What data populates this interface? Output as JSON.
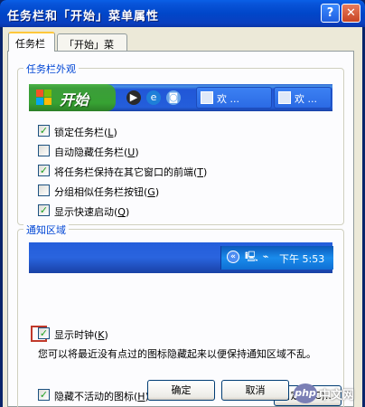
{
  "window": {
    "title": "任务栏和「开始」菜单属性",
    "help_label": "?",
    "close_label": "✕"
  },
  "tabs": [
    {
      "label": "任务栏",
      "active": true
    },
    {
      "label": "「开始」菜单",
      "active": false
    }
  ],
  "appearance": {
    "legend": "任务栏外观",
    "preview": {
      "start_label": "开始",
      "task_buttons": [
        "欢 ...",
        "欢 ..."
      ]
    },
    "options": [
      {
        "label": "锁定任务栏",
        "key": "L",
        "checked": true
      },
      {
        "label": "自动隐藏任务栏",
        "key": "U",
        "checked": false
      },
      {
        "label": "将任务栏保持在其它窗口的前端",
        "key": "T",
        "checked": true
      },
      {
        "label": "分组相似任务栏按钮",
        "key": "G",
        "checked": false
      },
      {
        "label": "显示快速启动",
        "key": "Q",
        "checked": true
      }
    ]
  },
  "notification": {
    "legend": "通知区域",
    "preview": {
      "arrow": "«",
      "clock": "下午 5:53"
    },
    "show_clock": {
      "label": "显示时钟",
      "key": "K",
      "checked": true
    },
    "description": "您可以将最近没有点过的图标隐藏起来以便保持通知区域不乱。",
    "hide_inactive": {
      "label": "隐藏不活动的图标",
      "key": "H",
      "checked": true
    },
    "customize_label": "自定义(C)..."
  },
  "footer": {
    "ok_label": "确定",
    "cancel_label": "取消"
  },
  "watermark": {
    "logo": "php",
    "text": "中文网"
  },
  "colors": {
    "title_bar": "#0054e3",
    "group_legend": "#0046d5",
    "check_mark": "#21a121",
    "highlight_box": "#c0392b"
  }
}
